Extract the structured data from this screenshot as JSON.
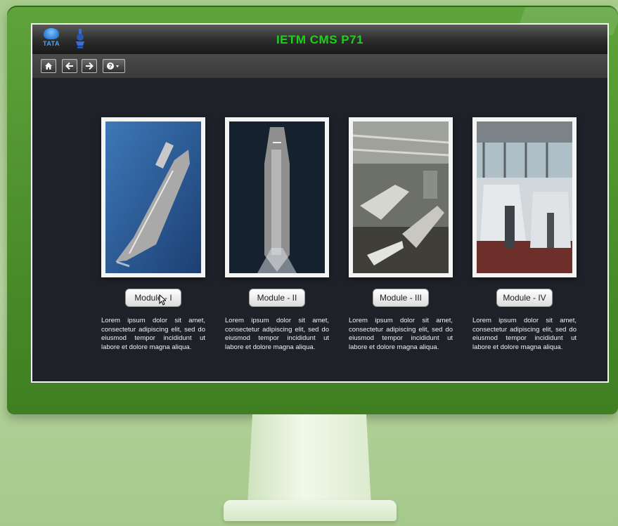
{
  "app": {
    "title": "IETM CMS P71",
    "logo_text": "TATA"
  },
  "toolbar": {
    "buttons": [
      {
        "icon": "home-icon"
      },
      {
        "icon": "back-arrow-icon"
      },
      {
        "icon": "forward-arrow-icon"
      },
      {
        "icon": "help-dropdown-icon"
      }
    ]
  },
  "modules": [
    {
      "label": "Module - I",
      "image": "aircraft-carrier-aerial",
      "description": "Lorem ipsum dolor sit amet, consectetur adipiscing elit, sed do eiusmod tempor incididunt ut labore et dolore magna aliqua."
    },
    {
      "label": "Module - II",
      "image": "aircraft-carrier-overhead",
      "description": "Lorem ipsum dolor sit amet, consectetur adipiscing elit, sed do eiusmod tempor incididunt ut labore et dolore magna aliqua."
    },
    {
      "label": "Module - III",
      "image": "hangar-aircraft",
      "description": "Lorem ipsum dolor sit amet, consectetur adipiscing elit, sed do eiusmod tempor incididunt ut labore et dolore magna aliqua."
    },
    {
      "label": "Module - IV",
      "image": "ship-bridge-consoles",
      "description": "Lorem ipsum dolor sit amet, consectetur adipiscing elit, sed do eiusmod tempor incididunt ut labore et dolore magna aliqua."
    }
  ],
  "colors": {
    "title_green": "#1ad21a",
    "screen_bg": "#1e2228",
    "bezel_green": "#4a8d2a"
  }
}
